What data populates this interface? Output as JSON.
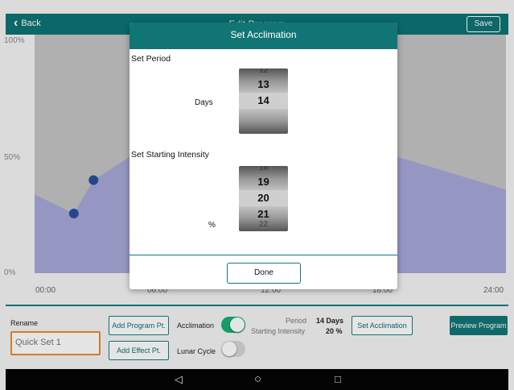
{
  "header": {
    "back_label": "Back",
    "title": "Edit Program",
    "save_label": "Save"
  },
  "chart": {
    "y_ticks": [
      "100%",
      "50%",
      "0%"
    ],
    "x_ticks": [
      "00:00",
      "06:00",
      "12:00",
      "18:00",
      "24:00"
    ],
    "fill_color": "#a8a8d8",
    "bg_color": "#c4c4c4",
    "point_color": "#2a4fa0"
  },
  "chart_data": {
    "type": "area",
    "x": [
      "00:00",
      "02:00",
      "03:00",
      "06:00",
      "12:00",
      "18:00",
      "24:00"
    ],
    "values": [
      33,
      25,
      39,
      55,
      62,
      50,
      35
    ],
    "ylim": [
      0,
      100
    ],
    "points": [
      {
        "x": "02:00",
        "y": 25
      },
      {
        "x": "03:00",
        "y": 39
      }
    ]
  },
  "modal": {
    "title": "Set Acclimation",
    "period_label": "Set Period",
    "days_label": "Days",
    "days_picker": [
      "12",
      "13",
      "14",
      ""
    ],
    "intensity_label": "Set Starting Intensity",
    "percent_label": "%",
    "percent_picker": [
      "18",
      "19",
      "20",
      "21",
      "22"
    ],
    "done_label": "Done"
  },
  "bottom": {
    "rename_label": "Rename",
    "rename_placeholder": "Quick Set 1",
    "add_program_pt": "Add Program Pt.",
    "add_effect_pt": "Add Effect Pt.",
    "acclimation_label": "Acclimation",
    "lunar_label": "Lunar Cycle",
    "period_label": "Period",
    "period_value": "14 Days",
    "intensity_label": "Starting Intensity",
    "intensity_value": "20 %",
    "set_acclimation": "Set Acclimation",
    "preview_program": "Preview Program",
    "toggle_on_color": "#16b071"
  },
  "nav": {
    "back_icon": "◁",
    "home_icon": "○",
    "recent_icon": "□"
  }
}
